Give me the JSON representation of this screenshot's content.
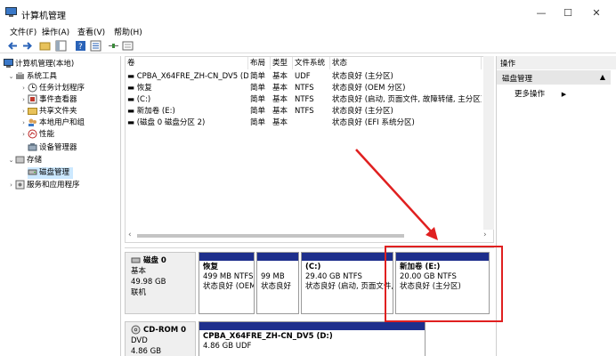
{
  "window": {
    "title": "计算机管理",
    "controls": [
      "—",
      "☐",
      "✕"
    ]
  },
  "menu": [
    "文件(F)",
    "操作(A)",
    "查看(V)",
    "帮助(H)"
  ],
  "tree": [
    {
      "label": "计算机管理(本地)",
      "level": 0,
      "icon": "computer-icon",
      "arrow": ""
    },
    {
      "label": "系统工具",
      "level": 1,
      "icon": "tools-icon",
      "arrow": "⌄"
    },
    {
      "label": "任务计划程序",
      "level": 2,
      "icon": "clock-icon",
      "arrow": "›"
    },
    {
      "label": "事件查看器",
      "level": 2,
      "icon": "event-icon",
      "arrow": "›"
    },
    {
      "label": "共享文件夹",
      "level": 2,
      "icon": "folder-icon",
      "arrow": "›"
    },
    {
      "label": "本地用户和组",
      "level": 2,
      "icon": "users-icon",
      "arrow": "›"
    },
    {
      "label": "性能",
      "level": 2,
      "icon": "performance-icon",
      "arrow": "›"
    },
    {
      "label": "设备管理器",
      "level": 2,
      "icon": "device-icon",
      "arrow": ""
    },
    {
      "label": "存储",
      "level": 1,
      "icon": "storage-icon",
      "arrow": "⌄"
    },
    {
      "label": "磁盘管理",
      "level": 2,
      "icon": "disk-icon",
      "arrow": "",
      "selected": true
    },
    {
      "label": "服务和应用程序",
      "level": 1,
      "icon": "services-icon",
      "arrow": "›"
    }
  ],
  "list": {
    "headers": [
      "卷",
      "布局",
      "类型",
      "文件系统",
      "状态",
      "容"
    ],
    "rows": [
      [
        "CPBA_X64FRE_ZH-CN_DV5 (D:)",
        "简单",
        "基本",
        "UDF",
        "状态良好 (主分区)",
        "4."
      ],
      [
        "恢复",
        "简单",
        "基本",
        "NTFS",
        "状态良好 (OEM 分区)",
        "4."
      ],
      [
        "(C:)",
        "简单",
        "基本",
        "NTFS",
        "状态良好 (启动, 页面文件, 故障转储, 主分区)",
        "29"
      ],
      [
        "新加卷 (E:)",
        "简单",
        "基本",
        "NTFS",
        "状态良好 (主分区)",
        "20"
      ],
      [
        "(磁盘 0 磁盘分区 2)",
        "简单",
        "基本",
        "",
        "状态良好 (EFI 系统分区)",
        "99"
      ]
    ]
  },
  "disks": [
    {
      "name": "磁盘 0",
      "type": "基本",
      "size": "49.98 GB",
      "status": "联机",
      "partitions": [
        {
          "title": "恢复",
          "size": "499 MB NTFS",
          "status": "状态良好 (OEM"
        },
        {
          "title": "",
          "size": "99 MB",
          "status": "状态良好"
        },
        {
          "title": "(C:)",
          "size": "29.40 GB NTFS",
          "status": "状态良好 (启动, 页面文件,"
        },
        {
          "title": "新加卷 (E:)",
          "size": "20.00 GB NTFS",
          "status": "状态良好 (主分区)"
        }
      ]
    },
    {
      "name": "CD-ROM 0",
      "type": "DVD",
      "size": "4.86 GB",
      "status": "",
      "partitions": [
        {
          "title": "CPBA_X64FRE_ZH-CN_DV5 (D:)",
          "size": "4.86 GB UDF",
          "status": ""
        }
      ]
    }
  ],
  "actions": {
    "header": "操作",
    "section": "磁盘管理",
    "more": "更多操作"
  },
  "colors": {
    "partition_bar": "#1e2f8c",
    "annotation": "#e02020",
    "selection": "#cce8ff"
  }
}
